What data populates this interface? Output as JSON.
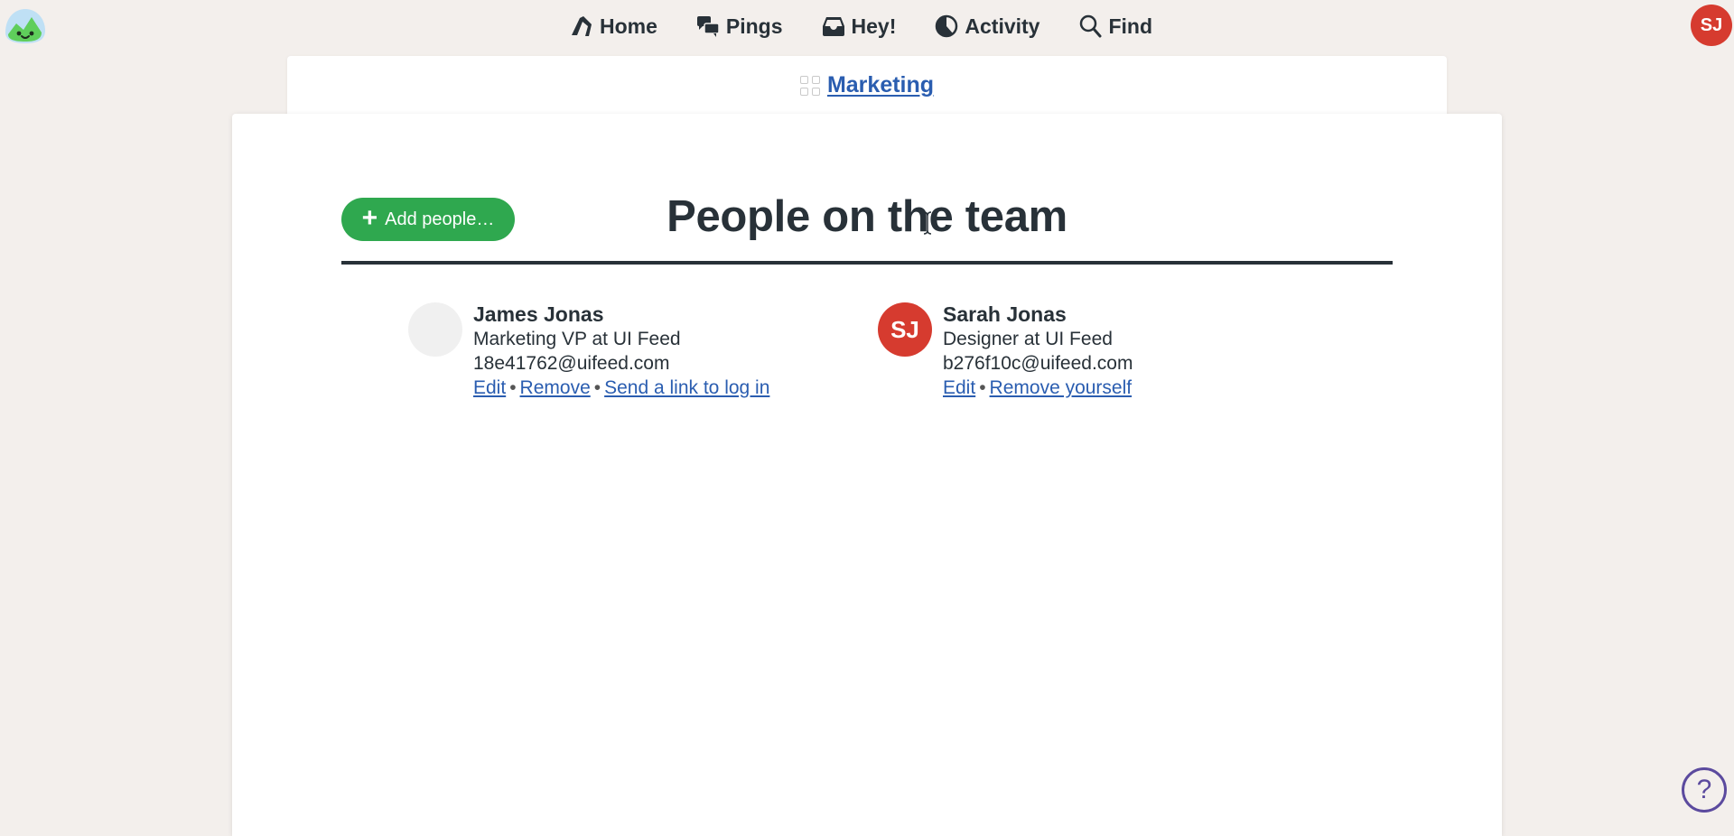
{
  "nav": {
    "items": [
      {
        "label": "Home",
        "icon": "home-icon"
      },
      {
        "label": "Pings",
        "icon": "pings-icon"
      },
      {
        "label": "Hey!",
        "icon": "hey-inbox-icon"
      },
      {
        "label": "Activity",
        "icon": "activity-icon"
      },
      {
        "label": "Find",
        "icon": "search-icon"
      }
    ],
    "user_initials": "SJ"
  },
  "breadcrumb": {
    "project": "Marketing",
    "icon": "grid-icon"
  },
  "main": {
    "title": "People on the team",
    "add_button_label": "Add people…",
    "add_button_icon": "plus-icon",
    "people": [
      {
        "name": "James Jonas",
        "role": "Marketing VP at UI Feed",
        "email": "18e41762@uifeed.com",
        "initials": "",
        "links": [
          "Edit",
          "Remove",
          "Send a link to log in"
        ]
      },
      {
        "name": "Sarah Jonas",
        "role": "Designer at UI Feed",
        "email": "b276f10c@uifeed.com",
        "initials": "SJ",
        "links": [
          "Edit",
          "Remove yourself"
        ]
      }
    ]
  },
  "help": {
    "label": "?"
  },
  "colors": {
    "accent_green": "#2fa84f",
    "link_blue": "#2a5db0",
    "avatar_red": "#d63b2f",
    "help_purple": "#5b4a9e",
    "background": "#f3efec"
  }
}
